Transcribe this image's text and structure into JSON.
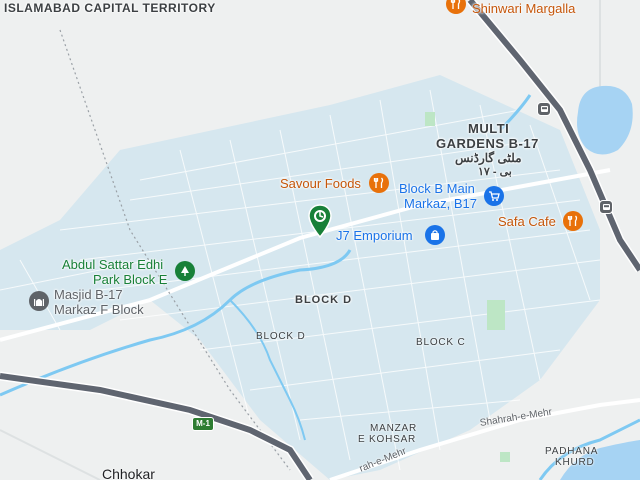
{
  "map": {
    "colors": {
      "land": "#eef0f0",
      "water": "#a6d3f3",
      "river": "#7ec9f2",
      "park": "#bde6c5",
      "block_fill": "#cfe3ec",
      "road": "#ffffff",
      "motorway": "#5f6570",
      "food_poi": "#e8710a",
      "shop_poi": "#1a73e8",
      "park_poi": "#188038",
      "worship_poi": "#5f6368"
    },
    "labels": {
      "territory": "ISLAMABAD CAPITAL TERRITORY",
      "multi_gardens_line1": "MULTI",
      "multi_gardens_line2": "GARDENS B-17",
      "multi_gardens_urdu": "ملٹی گارڈنس",
      "multi_gardens_urdu2": "بی - ١٧",
      "block_d_bold": "BLOCK D",
      "block_d_small": "BLOCK D",
      "block_c": "BLOCK C",
      "manzar_line1": "MANZAR",
      "manzar_line2": "E KOHSAR",
      "padhana_line1": "PADHANA",
      "padhana_line2": "KHURD",
      "chhokar": "Chhokar",
      "road_shahrah_1": "Shahrah-e-Mehr",
      "road_shahrah_2": "rah-e-Mehr",
      "motorway_shield": "M-1"
    },
    "pois": {
      "shinwari": {
        "name": "Shinwari Margalla",
        "icon": "restaurant-icon"
      },
      "savour": {
        "name": "Savour Foods",
        "icon": "restaurant-icon"
      },
      "block_b_main_l1": "Block B Main",
      "block_b_main_l2": "Markaz, B17",
      "block_b_icon": "shopping-cart-icon",
      "safa": {
        "name": "Safa Cafe",
        "icon": "restaurant-icon"
      },
      "j7": {
        "name": "J7 Emporium",
        "icon": "shopping-bag-icon"
      },
      "edhi_l1": "Abdul Sattar Edhi",
      "edhi_l2": "Park Block E",
      "edhi_icon": "tree-icon",
      "masjid_l1": "Masjid B-17",
      "masjid_l2": "Markaz F Block",
      "masjid_icon": "mosque-icon",
      "green_marker_icon": "location-pin-icon"
    }
  }
}
